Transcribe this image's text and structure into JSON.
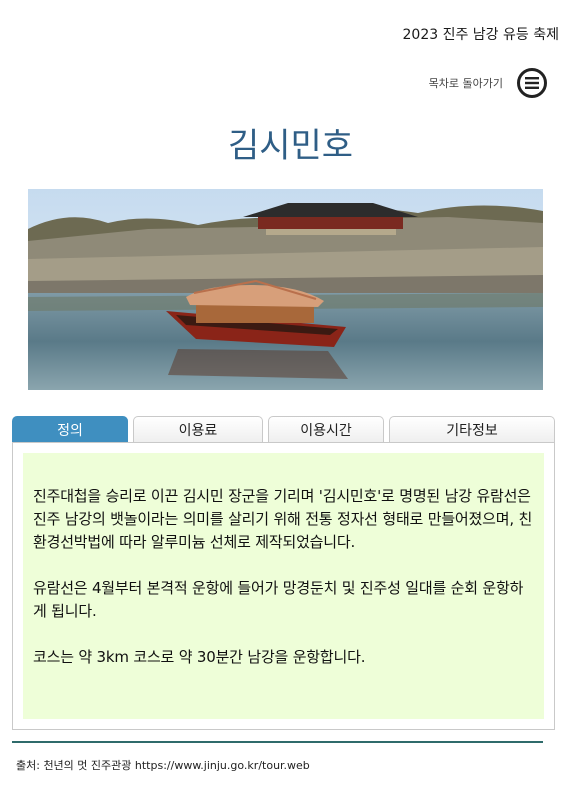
{
  "header": {
    "event_title": "2023 진주 남강 유등 축제"
  },
  "toc": {
    "label": "목차로 돌아가기",
    "icon": "menu-circle-icon"
  },
  "page": {
    "title": "김시민호"
  },
  "tabs": [
    {
      "label": "정의",
      "active": true
    },
    {
      "label": "이용료",
      "active": false
    },
    {
      "label": "이용시간",
      "active": false
    },
    {
      "label": "기타정보",
      "active": false
    }
  ],
  "content": {
    "paragraphs": [
      "진주대첩을 승리로 이끈 김시민 장군을 기리며 '김시민호'로 명명된 남강 유람선은 진주 남강의 뱃놀이라는 의미를 살리기 위해 전통 정자선 형태로 만들어졌으며, 친환경선박법에 따라 알루미늄 선체로 제작되었습니다.",
      "유람선은 4월부터 본격적 운항에 들어가 망경둔치 및 진주성 일대를 순회 운항하게 됩니다.",
      "코스는 약 3km 코스로  약 30분간 남강을 운항합니다."
    ]
  },
  "footer": {
    "source": "출처: 천년의 멋 진주관광 https://www.jinju.go.kr/tour.web"
  },
  "colors": {
    "title": "#2f5e86",
    "tab_active": "#3f8fc0",
    "panel_bg": "#eefed8",
    "divider": "#2f6b6b"
  }
}
